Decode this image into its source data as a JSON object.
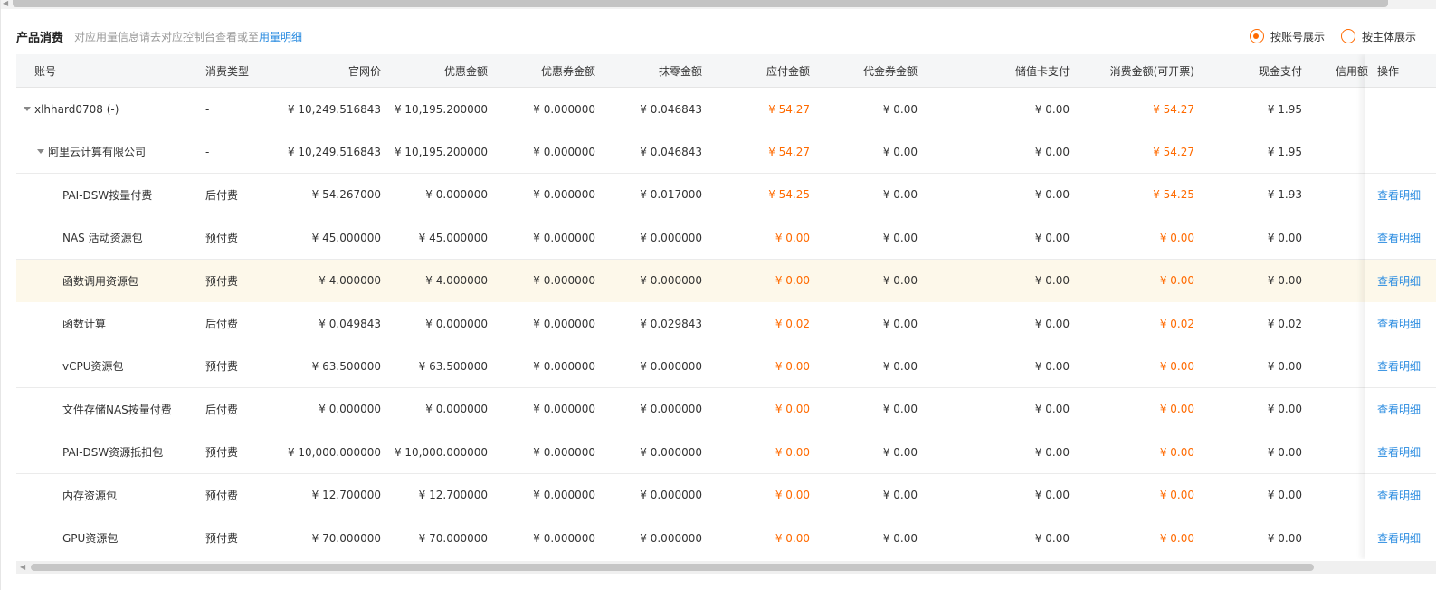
{
  "header": {
    "title": "产品消费",
    "hint": "对应用量信息请去对应控制台查看或至",
    "hint_link": "用量明细"
  },
  "view_mode": {
    "options": [
      {
        "label": "按账号展示",
        "checked": true
      },
      {
        "label": "按主体展示",
        "checked": false
      }
    ]
  },
  "table": {
    "columns": [
      "账号",
      "消费类型",
      "官网价",
      "优惠金额",
      "优惠券金额",
      "抹零金额",
      "应付金额",
      "代金券金额",
      "储值卡支付",
      "消费金额(可开票)",
      "现金支付",
      "信用额",
      "操作"
    ],
    "rows": [
      {
        "name": "xlhhard0708  (-)",
        "level": 0,
        "expand": true,
        "type": "-",
        "list": "¥ 10,249.516843",
        "discount": "¥ 10,195.200000",
        "coupon": "¥ 0.000000",
        "round": "¥ 0.046843",
        "payable": "¥ 54.27",
        "voucher": "¥ 0.00",
        "card": "¥ 0.00",
        "invoice": "¥ 54.27",
        "cash": "¥ 1.95",
        "action": ""
      },
      {
        "name": "阿里云计算有限公司",
        "level": 1,
        "expand": true,
        "type": "-",
        "list": "¥ 10,249.516843",
        "discount": "¥ 10,195.200000",
        "coupon": "¥ 0.000000",
        "round": "¥ 0.046843",
        "payable": "¥ 54.27",
        "voucher": "¥ 0.00",
        "card": "¥ 0.00",
        "invoice": "¥ 54.27",
        "cash": "¥ 1.95",
        "action": ""
      },
      {
        "name": "PAI-DSW按量付费",
        "level": 2,
        "expand": false,
        "type": "后付费",
        "list": "¥ 54.267000",
        "discount": "¥ 0.000000",
        "coupon": "¥ 0.000000",
        "round": "¥ 0.017000",
        "payable": "¥ 54.25",
        "voucher": "¥ 0.00",
        "card": "¥ 0.00",
        "invoice": "¥ 54.25",
        "cash": "¥ 1.93",
        "action": "查看明细"
      },
      {
        "name": "NAS 活动资源包",
        "level": 2,
        "expand": false,
        "type": "预付费",
        "list": "¥ 45.000000",
        "discount": "¥ 45.000000",
        "coupon": "¥ 0.000000",
        "round": "¥ 0.000000",
        "payable": "¥ 0.00",
        "voucher": "¥ 0.00",
        "card": "¥ 0.00",
        "invoice": "¥ 0.00",
        "cash": "¥ 0.00",
        "action": "查看明细"
      },
      {
        "name": "函数调用资源包",
        "level": 2,
        "expand": false,
        "type": "预付费",
        "list": "¥ 4.000000",
        "discount": "¥ 4.000000",
        "coupon": "¥ 0.000000",
        "round": "¥ 0.000000",
        "payable": "¥ 0.00",
        "voucher": "¥ 0.00",
        "card": "¥ 0.00",
        "invoice": "¥ 0.00",
        "cash": "¥ 0.00",
        "action": "查看明细",
        "highlight": true
      },
      {
        "name": "函数计算",
        "level": 2,
        "expand": false,
        "type": "后付费",
        "list": "¥ 0.049843",
        "discount": "¥ 0.000000",
        "coupon": "¥ 0.000000",
        "round": "¥ 0.029843",
        "payable": "¥ 0.02",
        "voucher": "¥ 0.00",
        "card": "¥ 0.00",
        "invoice": "¥ 0.02",
        "cash": "¥ 0.02",
        "action": "查看明细"
      },
      {
        "name": "vCPU资源包",
        "level": 2,
        "expand": false,
        "type": "预付费",
        "list": "¥ 63.500000",
        "discount": "¥ 63.500000",
        "coupon": "¥ 0.000000",
        "round": "¥ 0.000000",
        "payable": "¥ 0.00",
        "voucher": "¥ 0.00",
        "card": "¥ 0.00",
        "invoice": "¥ 0.00",
        "cash": "¥ 0.00",
        "action": "查看明细"
      },
      {
        "name": "文件存储NAS按量付费",
        "level": 2,
        "expand": false,
        "type": "后付费",
        "list": "¥ 0.000000",
        "discount": "¥ 0.000000",
        "coupon": "¥ 0.000000",
        "round": "¥ 0.000000",
        "payable": "¥ 0.00",
        "voucher": "¥ 0.00",
        "card": "¥ 0.00",
        "invoice": "¥ 0.00",
        "cash": "¥ 0.00",
        "action": "查看明细"
      },
      {
        "name": "PAI-DSW资源抵扣包",
        "level": 2,
        "expand": false,
        "type": "预付费",
        "list": "¥ 10,000.000000",
        "discount": "¥ 10,000.000000",
        "coupon": "¥ 0.000000",
        "round": "¥ 0.000000",
        "payable": "¥ 0.00",
        "voucher": "¥ 0.00",
        "card": "¥ 0.00",
        "invoice": "¥ 0.00",
        "cash": "¥ 0.00",
        "action": "查看明细"
      },
      {
        "name": "内存资源包",
        "level": 2,
        "expand": false,
        "type": "预付费",
        "list": "¥ 12.700000",
        "discount": "¥ 12.700000",
        "coupon": "¥ 0.000000",
        "round": "¥ 0.000000",
        "payable": "¥ 0.00",
        "voucher": "¥ 0.00",
        "card": "¥ 0.00",
        "invoice": "¥ 0.00",
        "cash": "¥ 0.00",
        "action": "查看明细"
      },
      {
        "name": "GPU资源包",
        "level": 2,
        "expand": false,
        "type": "预付费",
        "list": "¥ 70.000000",
        "discount": "¥ 70.000000",
        "coupon": "¥ 0.000000",
        "round": "¥ 0.000000",
        "payable": "¥ 0.00",
        "voucher": "¥ 0.00",
        "card": "¥ 0.00",
        "invoice": "¥ 0.00",
        "cash": "¥ 0.00",
        "action": "查看明细"
      }
    ]
  },
  "colors": {
    "accent": "#ff6a00",
    "link": "#2b8ce0",
    "highlight_row": "#fdf8ea",
    "header_bg": "#f5f6f7"
  }
}
